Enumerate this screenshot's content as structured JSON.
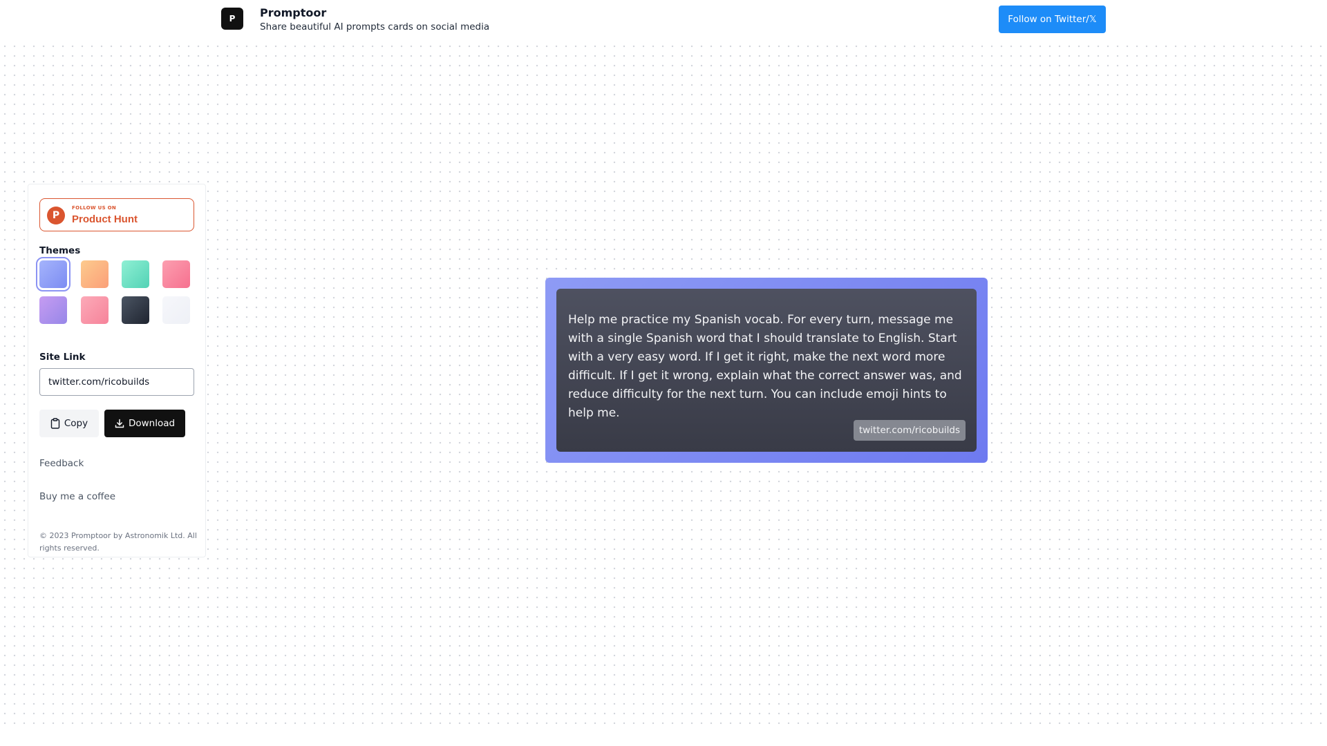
{
  "header": {
    "logo_glyph": "P",
    "title": "Promptoor",
    "subtitle": "Share beautiful AI prompts cards on social media",
    "follow_button": "Follow on Twitter/𝕏"
  },
  "sidebar": {
    "product_hunt": {
      "logo_letter": "P",
      "small_text": "FOLLOW US ON",
      "big_text": "Product Hunt",
      "color": "#da552f"
    },
    "themes_label": "Themes",
    "themes": [
      {
        "name": "indigo",
        "gradient": [
          "#a5b4fc",
          "#7c8cf2"
        ],
        "selected": true
      },
      {
        "name": "orange",
        "gradient": [
          "#fdcb8e",
          "#fb9f78"
        ],
        "selected": false
      },
      {
        "name": "teal",
        "gradient": [
          "#8ff0d4",
          "#52d2b5"
        ],
        "selected": false
      },
      {
        "name": "pink",
        "gradient": [
          "#fc9fb0",
          "#f6708f"
        ],
        "selected": false
      },
      {
        "name": "purple",
        "gradient": [
          "#c69cf2",
          "#9787e8"
        ],
        "selected": false
      },
      {
        "name": "rose",
        "gradient": [
          "#fcaab8",
          "#f6839a"
        ],
        "selected": false
      },
      {
        "name": "dark",
        "gradient": [
          "#4b5563",
          "#1f2430"
        ],
        "selected": false
      },
      {
        "name": "light",
        "gradient": [
          "#f6f7fb",
          "#eef0f6"
        ],
        "selected": false
      }
    ],
    "site_link_label": "Site Link",
    "site_link_value": "twitter.com/ricobuilds",
    "copy_button": "Copy",
    "download_button": "Download",
    "feedback_link": "Feedback",
    "coffee_link": "Buy me a coffee",
    "copyright": "© 2023 Promptoor by Astronomik Ltd. All rights reserved."
  },
  "card": {
    "prompt": "Help me practice my Spanish vocab. For every turn, message me with a single Spanish word that I should translate to English. Start with a very easy word. If I get it right, make the next word more difficult. If I get it wrong, explain what the correct answer was, and reduce difficulty for the next turn. You can include emoji hints to help me.",
    "link": "twitter.com/ricobuilds"
  },
  "colors": {
    "accent_blue": "#1d8cf8",
    "card_border_gradient": [
      "#8e9bf5",
      "#6e7af0"
    ],
    "card_inner": "#44464f"
  }
}
